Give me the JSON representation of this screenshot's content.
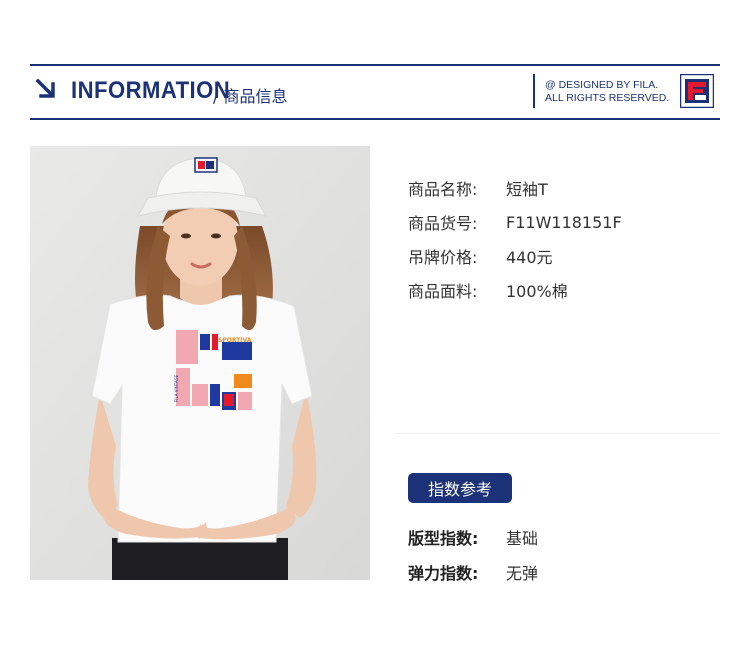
{
  "header": {
    "title": "INFORMATION",
    "subtitle": "/ 商品信息",
    "copyright_line1": "@ DESIGNED BY FILA.",
    "copyright_line2": "ALL RIGHTS RESERVED.",
    "logo": "FILA"
  },
  "photo": {
    "hat_logo": "FILA",
    "shirt_text": "SPORTIVA",
    "shirt_text_small": "FILA VINTAGE"
  },
  "specs": [
    {
      "label": "商品名称:",
      "value": "短袖T"
    },
    {
      "label": "商品货号:",
      "value": "F11W118151F"
    },
    {
      "label": "吊牌价格:",
      "value": "440元"
    },
    {
      "label": "商品面料:",
      "value": "100%棉"
    }
  ],
  "index_section": {
    "title": "指数参考",
    "rows": [
      {
        "label": "版型指数:",
        "value": "基础"
      },
      {
        "label": "弹力指数:",
        "value": "无弹"
      }
    ]
  },
  "colors": {
    "brand_navy": "#1c3278",
    "fila_red": "#e4192e"
  }
}
